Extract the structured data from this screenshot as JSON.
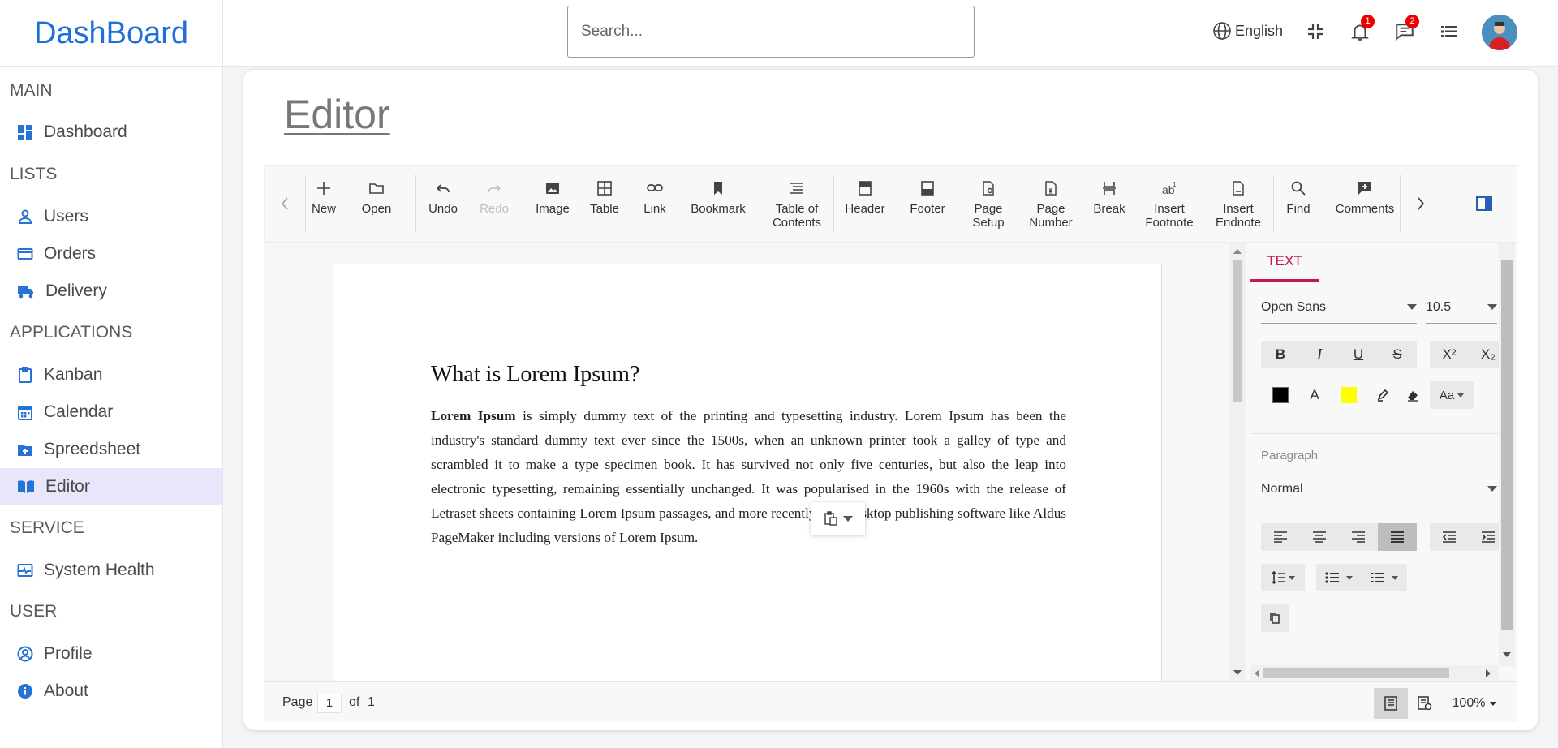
{
  "app": {
    "brand": "DashBoard"
  },
  "topbar": {
    "search_placeholder": "Search...",
    "language": "English",
    "notification_count": "1",
    "message_count": "2"
  },
  "sidebar": {
    "sections": [
      {
        "title": "MAIN",
        "items": [
          {
            "label": "Dashboard",
            "icon": "dashboard-icon"
          }
        ]
      },
      {
        "title": "LISTS",
        "items": [
          {
            "label": "Users",
            "icon": "user-icon"
          },
          {
            "label": "Orders",
            "icon": "credit-card-icon"
          },
          {
            "label": "Delivery",
            "icon": "truck-icon"
          }
        ]
      },
      {
        "title": "APPLICATIONS",
        "items": [
          {
            "label": "Kanban",
            "icon": "clipboard-icon"
          },
          {
            "label": "Calendar",
            "icon": "calendar-icon"
          },
          {
            "label": "Spreedsheet",
            "icon": "folder-add-icon"
          },
          {
            "label": "Editor",
            "icon": "book-icon",
            "active": true
          }
        ]
      },
      {
        "title": "SERVICE",
        "items": [
          {
            "label": "System Health",
            "icon": "monitor-heart-icon"
          }
        ]
      },
      {
        "title": "USER",
        "items": [
          {
            "label": "Profile",
            "icon": "account-circle-icon"
          },
          {
            "label": "About",
            "icon": "info-icon"
          }
        ]
      }
    ]
  },
  "page": {
    "title": "Editor"
  },
  "toolbar": {
    "items": [
      {
        "label": "New",
        "icon": "plus-icon"
      },
      {
        "label": "Open",
        "icon": "folder-icon"
      },
      {
        "label": "Undo",
        "icon": "undo-icon"
      },
      {
        "label": "Redo",
        "icon": "redo-icon",
        "disabled": true
      },
      {
        "label": "Image",
        "icon": "image-icon"
      },
      {
        "label": "Table",
        "icon": "table-icon"
      },
      {
        "label": "Link",
        "icon": "link-icon"
      },
      {
        "label": "Bookmark",
        "icon": "bookmark-icon"
      },
      {
        "label": "Table of Contents",
        "label_line1": "Table of",
        "label_line2": "Contents",
        "icon": "toc-icon"
      },
      {
        "label": "Header",
        "icon": "header-icon"
      },
      {
        "label": "Footer",
        "icon": "footer-icon"
      },
      {
        "label": "Page Setup",
        "label_line1": "Page",
        "label_line2": "Setup",
        "icon": "page-setup-icon"
      },
      {
        "label": "Page Number",
        "label_line1": "Page",
        "label_line2": "Number",
        "icon": "page-number-icon"
      },
      {
        "label": "Break",
        "icon": "break-icon"
      },
      {
        "label": "Insert Footnote",
        "label_line1": "Insert",
        "label_line2": "Footnote",
        "icon": "footnote-icon"
      },
      {
        "label": "Insert Endnote",
        "label_line1": "Insert",
        "label_line2": "Endnote",
        "icon": "endnote-icon"
      },
      {
        "label": "Find",
        "icon": "search-icon"
      },
      {
        "label": "Comments",
        "icon": "comment-add-icon"
      }
    ]
  },
  "document": {
    "heading": "What is Lorem Ipsum?",
    "bold_lead": "Lorem Ipsum",
    "body": " is simply dummy text of the printing and typesetting industry. Lorem Ipsum has been the industry's standard dummy text ever since the 1500s, when an unknown printer took a galley of type and scrambled it to make a type specimen book. It has survived not only five centuries, but also the leap into electronic typesetting, remaining essentially unchanged. It was popularised in the 1960s with the release of Letraset sheets containing Lorem Ipsum passages, and more recently with desktop publishing software like Aldus PageMaker including versions of Lorem Ipsum."
  },
  "properties": {
    "tab": "TEXT",
    "font_family": "Open Sans",
    "font_size": "10.5",
    "paragraph_label": "Paragraph",
    "paragraph_style": "Normal",
    "bold": "B",
    "italic": "I",
    "underline": "U",
    "strikethrough": "S",
    "superscript": "X²",
    "subscript": "X₂",
    "font_color_glyph": "A",
    "change_case": "Aa",
    "font_color": "#000000",
    "highlight_color": "#ffff00",
    "accent_color": "#c2185b"
  },
  "statusbar": {
    "page_label": "Page",
    "current_page": "1",
    "of_label": "of",
    "total_pages": "1",
    "zoom": "100%"
  }
}
